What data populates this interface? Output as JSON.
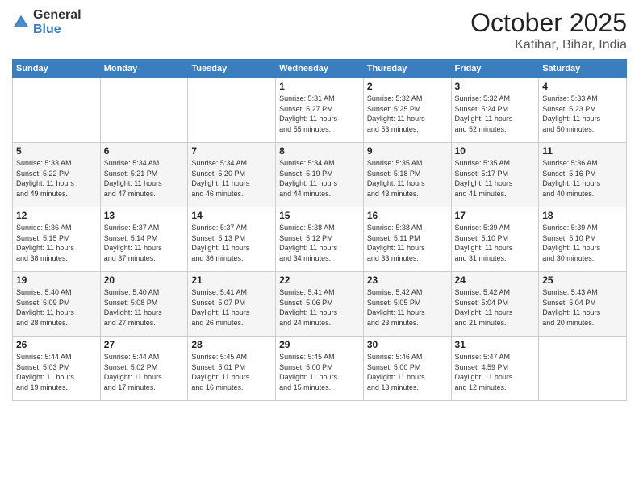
{
  "header": {
    "logo_general": "General",
    "logo_blue": "Blue",
    "month": "October 2025",
    "location": "Katihar, Bihar, India"
  },
  "days_of_week": [
    "Sunday",
    "Monday",
    "Tuesday",
    "Wednesday",
    "Thursday",
    "Friday",
    "Saturday"
  ],
  "weeks": [
    [
      {
        "day": "",
        "info": ""
      },
      {
        "day": "",
        "info": ""
      },
      {
        "day": "",
        "info": ""
      },
      {
        "day": "1",
        "info": "Sunrise: 5:31 AM\nSunset: 5:27 PM\nDaylight: 11 hours\nand 55 minutes."
      },
      {
        "day": "2",
        "info": "Sunrise: 5:32 AM\nSunset: 5:25 PM\nDaylight: 11 hours\nand 53 minutes."
      },
      {
        "day": "3",
        "info": "Sunrise: 5:32 AM\nSunset: 5:24 PM\nDaylight: 11 hours\nand 52 minutes."
      },
      {
        "day": "4",
        "info": "Sunrise: 5:33 AM\nSunset: 5:23 PM\nDaylight: 11 hours\nand 50 minutes."
      }
    ],
    [
      {
        "day": "5",
        "info": "Sunrise: 5:33 AM\nSunset: 5:22 PM\nDaylight: 11 hours\nand 49 minutes."
      },
      {
        "day": "6",
        "info": "Sunrise: 5:34 AM\nSunset: 5:21 PM\nDaylight: 11 hours\nand 47 minutes."
      },
      {
        "day": "7",
        "info": "Sunrise: 5:34 AM\nSunset: 5:20 PM\nDaylight: 11 hours\nand 46 minutes."
      },
      {
        "day": "8",
        "info": "Sunrise: 5:34 AM\nSunset: 5:19 PM\nDaylight: 11 hours\nand 44 minutes."
      },
      {
        "day": "9",
        "info": "Sunrise: 5:35 AM\nSunset: 5:18 PM\nDaylight: 11 hours\nand 43 minutes."
      },
      {
        "day": "10",
        "info": "Sunrise: 5:35 AM\nSunset: 5:17 PM\nDaylight: 11 hours\nand 41 minutes."
      },
      {
        "day": "11",
        "info": "Sunrise: 5:36 AM\nSunset: 5:16 PM\nDaylight: 11 hours\nand 40 minutes."
      }
    ],
    [
      {
        "day": "12",
        "info": "Sunrise: 5:36 AM\nSunset: 5:15 PM\nDaylight: 11 hours\nand 38 minutes."
      },
      {
        "day": "13",
        "info": "Sunrise: 5:37 AM\nSunset: 5:14 PM\nDaylight: 11 hours\nand 37 minutes."
      },
      {
        "day": "14",
        "info": "Sunrise: 5:37 AM\nSunset: 5:13 PM\nDaylight: 11 hours\nand 36 minutes."
      },
      {
        "day": "15",
        "info": "Sunrise: 5:38 AM\nSunset: 5:12 PM\nDaylight: 11 hours\nand 34 minutes."
      },
      {
        "day": "16",
        "info": "Sunrise: 5:38 AM\nSunset: 5:11 PM\nDaylight: 11 hours\nand 33 minutes."
      },
      {
        "day": "17",
        "info": "Sunrise: 5:39 AM\nSunset: 5:10 PM\nDaylight: 11 hours\nand 31 minutes."
      },
      {
        "day": "18",
        "info": "Sunrise: 5:39 AM\nSunset: 5:10 PM\nDaylight: 11 hours\nand 30 minutes."
      }
    ],
    [
      {
        "day": "19",
        "info": "Sunrise: 5:40 AM\nSunset: 5:09 PM\nDaylight: 11 hours\nand 28 minutes."
      },
      {
        "day": "20",
        "info": "Sunrise: 5:40 AM\nSunset: 5:08 PM\nDaylight: 11 hours\nand 27 minutes."
      },
      {
        "day": "21",
        "info": "Sunrise: 5:41 AM\nSunset: 5:07 PM\nDaylight: 11 hours\nand 26 minutes."
      },
      {
        "day": "22",
        "info": "Sunrise: 5:41 AM\nSunset: 5:06 PM\nDaylight: 11 hours\nand 24 minutes."
      },
      {
        "day": "23",
        "info": "Sunrise: 5:42 AM\nSunset: 5:05 PM\nDaylight: 11 hours\nand 23 minutes."
      },
      {
        "day": "24",
        "info": "Sunrise: 5:42 AM\nSunset: 5:04 PM\nDaylight: 11 hours\nand 21 minutes."
      },
      {
        "day": "25",
        "info": "Sunrise: 5:43 AM\nSunset: 5:04 PM\nDaylight: 11 hours\nand 20 minutes."
      }
    ],
    [
      {
        "day": "26",
        "info": "Sunrise: 5:44 AM\nSunset: 5:03 PM\nDaylight: 11 hours\nand 19 minutes."
      },
      {
        "day": "27",
        "info": "Sunrise: 5:44 AM\nSunset: 5:02 PM\nDaylight: 11 hours\nand 17 minutes."
      },
      {
        "day": "28",
        "info": "Sunrise: 5:45 AM\nSunset: 5:01 PM\nDaylight: 11 hours\nand 16 minutes."
      },
      {
        "day": "29",
        "info": "Sunrise: 5:45 AM\nSunset: 5:00 PM\nDaylight: 11 hours\nand 15 minutes."
      },
      {
        "day": "30",
        "info": "Sunrise: 5:46 AM\nSunset: 5:00 PM\nDaylight: 11 hours\nand 13 minutes."
      },
      {
        "day": "31",
        "info": "Sunrise: 5:47 AM\nSunset: 4:59 PM\nDaylight: 11 hours\nand 12 minutes."
      },
      {
        "day": "",
        "info": ""
      }
    ]
  ]
}
